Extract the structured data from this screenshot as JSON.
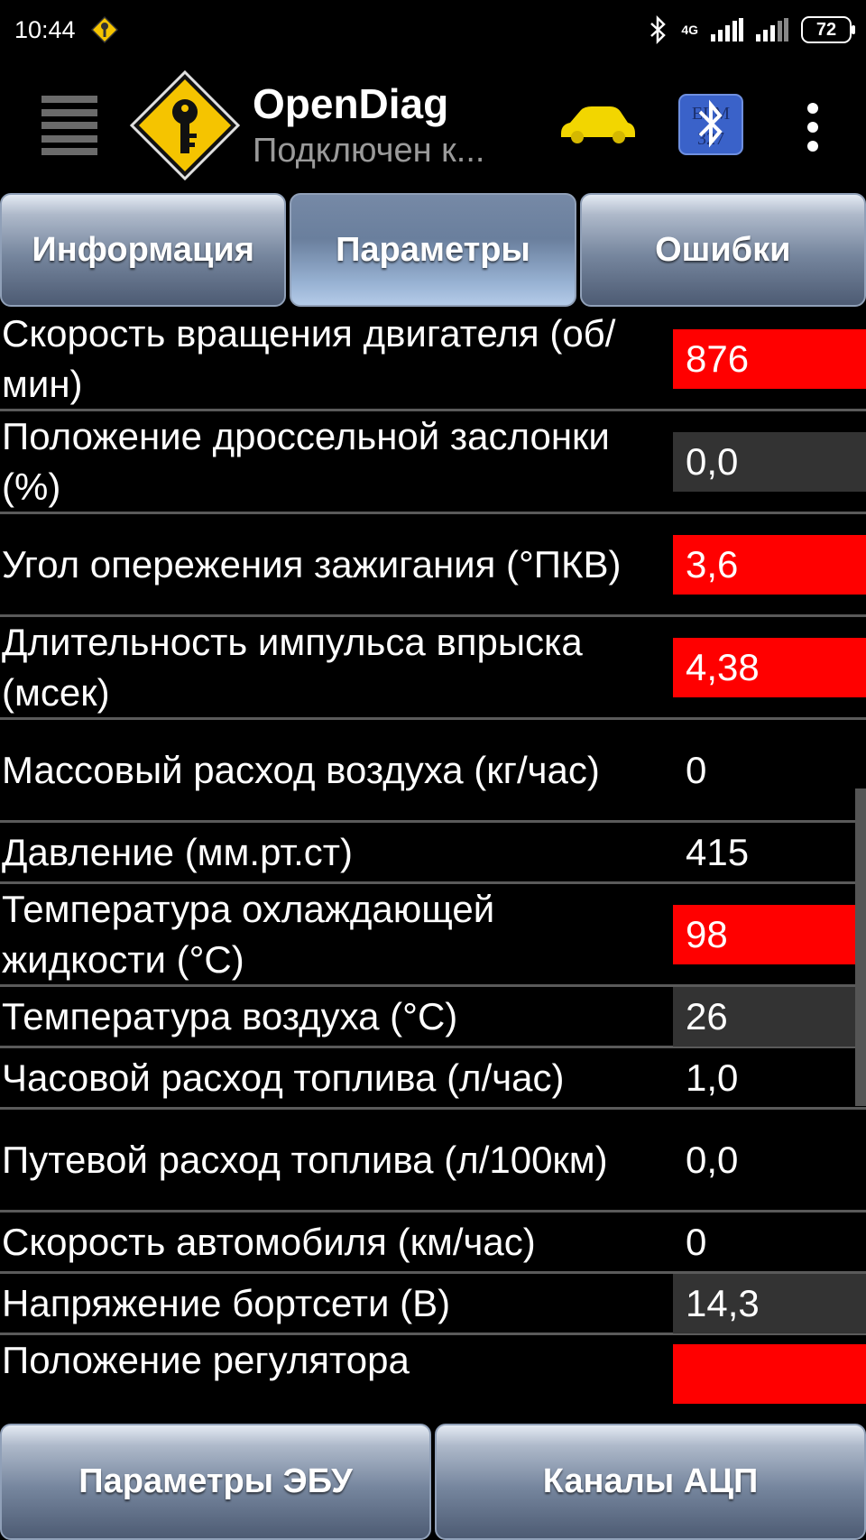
{
  "status_bar": {
    "time": "10:44",
    "network": "4G",
    "battery": "72"
  },
  "app": {
    "title": "OpenDiag",
    "subtitle": "Подключен к..."
  },
  "tabs": [
    {
      "label": "Информация",
      "active": false
    },
    {
      "label": "Параметры",
      "active": true
    },
    {
      "label": "Ошибки",
      "active": false
    }
  ],
  "parameters": [
    {
      "label": "Скорость вращения двигателя (об/мин)",
      "value": "876",
      "status": "red"
    },
    {
      "label": "Положение дроссельной заслонки (%)",
      "value": "0,0",
      "status": "gray"
    },
    {
      "label": "Угол опережения зажигания (°ПКВ)",
      "value": "3,6",
      "status": "red"
    },
    {
      "label": "Длительность импульса впрыска (мсек)",
      "value": "4,38",
      "status": "red"
    },
    {
      "label": "Массовый расход воздуха (кг/час)",
      "value": "0",
      "status": "plain"
    },
    {
      "label": "Давление (мм.рт.ст)",
      "value": "415",
      "status": "plain"
    },
    {
      "label": "Температура охлаждающей жидкости (°С)",
      "value": "98",
      "status": "red"
    },
    {
      "label": "Температура воздуха (°С)",
      "value": "26",
      "status": "gray"
    },
    {
      "label": "Часовой расход топлива (л/час)",
      "value": "1,0",
      "status": "plain"
    },
    {
      "label": "Путевой расход топлива (л/100км)",
      "value": "0,0",
      "status": "plain"
    },
    {
      "label": "Скорость автомобиля (км/час)",
      "value": "0",
      "status": "plain"
    },
    {
      "label": "Напряжение бортсети (В)",
      "value": "14,3",
      "status": "gray"
    },
    {
      "label": "Положение регулятора",
      "value": "",
      "status": "red"
    }
  ],
  "bottom_buttons": [
    {
      "label": "Параметры ЭБУ"
    },
    {
      "label": "Каналы АЦП"
    }
  ],
  "colors": {
    "alert": "#ff0000",
    "neutral": "#333333",
    "car": "#f2d600",
    "logo": "#f5c400"
  },
  "icons": [
    "key-warning-icon",
    "bluetooth-icon",
    "signal-icon",
    "car-icon",
    "menu-icon",
    "hamburger-icon",
    "elm327-bluetooth-icon",
    "overflow-menu-icon"
  ]
}
